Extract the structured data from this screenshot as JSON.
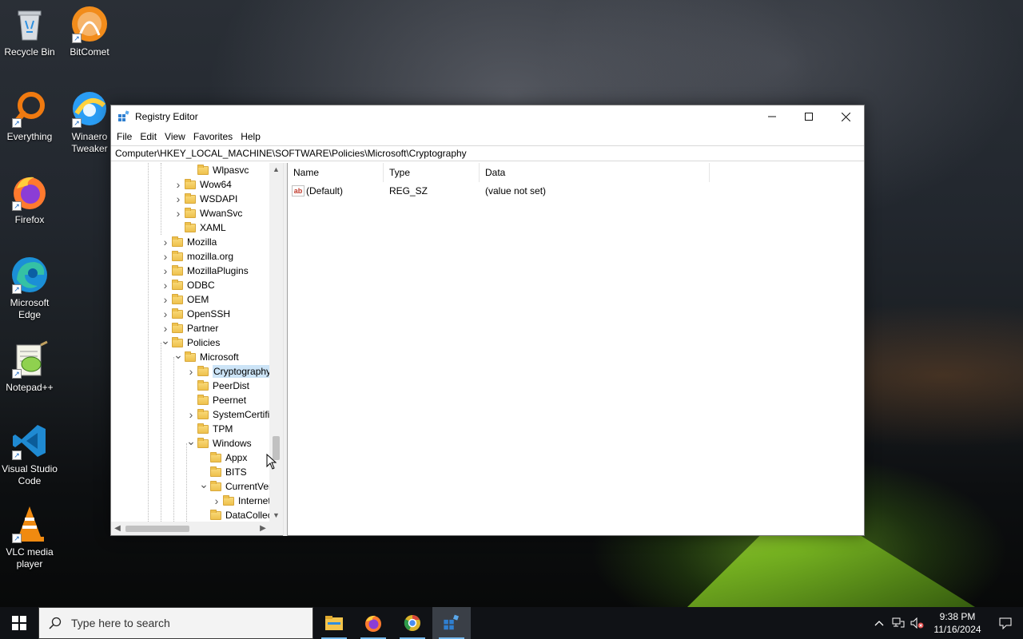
{
  "desktop": {
    "icons": [
      {
        "label": "Recycle Bin",
        "icon": "recycle-bin-icon"
      },
      {
        "label": "BitComet",
        "icon": "bitcomet-icon"
      },
      {
        "label": "Everything",
        "icon": "everything-search-icon"
      },
      {
        "label": "Winaero Tweaker",
        "icon": "winaero-tweaker-icon"
      },
      {
        "label": "Firefox",
        "icon": "firefox-icon"
      },
      {
        "label": "Microsoft Edge",
        "icon": "edge-icon"
      },
      {
        "label": "Notepad++",
        "icon": "notepadpp-icon"
      },
      {
        "label": "Visual Studio Code",
        "icon": "vscode-icon"
      },
      {
        "label": "VLC media player",
        "icon": "vlc-icon"
      }
    ]
  },
  "window": {
    "title": "Registry Editor",
    "menu": [
      "File",
      "Edit",
      "View",
      "Favorites",
      "Help"
    ],
    "address": "Computer\\HKEY_LOCAL_MACHINE\\SOFTWARE\\Policies\\Microsoft\\Cryptography",
    "tree": [
      {
        "label": "Wlpasvc",
        "expander": "",
        "selected": false
      },
      {
        "label": "Wow64",
        "expander": "collapsed",
        "selected": false
      },
      {
        "label": "WSDAPI",
        "expander": "collapsed",
        "selected": false
      },
      {
        "label": "WwanSvc",
        "expander": "collapsed",
        "selected": false
      },
      {
        "label": "XAML",
        "expander": "",
        "selected": false
      },
      {
        "label": "Mozilla",
        "expander": "collapsed",
        "selected": false
      },
      {
        "label": "mozilla.org",
        "expander": "collapsed",
        "selected": false
      },
      {
        "label": "MozillaPlugins",
        "expander": "collapsed",
        "selected": false
      },
      {
        "label": "ODBC",
        "expander": "collapsed",
        "selected": false
      },
      {
        "label": "OEM",
        "expander": "collapsed",
        "selected": false
      },
      {
        "label": "OpenSSH",
        "expander": "collapsed",
        "selected": false
      },
      {
        "label": "Partner",
        "expander": "collapsed",
        "selected": false
      },
      {
        "label": "Policies",
        "expander": "expanded",
        "selected": false
      },
      {
        "label": "Microsoft",
        "expander": "expanded",
        "selected": false
      },
      {
        "label": "Cryptography",
        "expander": "collapsed",
        "selected": true
      },
      {
        "label": "PeerDist",
        "expander": "",
        "selected": false
      },
      {
        "label": "Peernet",
        "expander": "",
        "selected": false
      },
      {
        "label": "SystemCertific",
        "expander": "collapsed",
        "selected": false
      },
      {
        "label": "TPM",
        "expander": "",
        "selected": false
      },
      {
        "label": "Windows",
        "expander": "expanded",
        "selected": false
      },
      {
        "label": "Appx",
        "expander": "",
        "selected": false
      },
      {
        "label": "BITS",
        "expander": "",
        "selected": false
      },
      {
        "label": "CurrentVers",
        "expander": "expanded",
        "selected": false
      },
      {
        "label": "Internet",
        "expander": "collapsed",
        "selected": false
      },
      {
        "label": "DataCollect",
        "expander": "",
        "selected": false
      }
    ],
    "columns": [
      "Name",
      "Type",
      "Data"
    ],
    "values": [
      {
        "name": "(Default)",
        "type": "REG_SZ",
        "data": "(value not set)",
        "icon": "string-value-icon"
      }
    ]
  },
  "taskbar": {
    "search_placeholder": "Type here to search",
    "apps": [
      {
        "name": "file-explorer",
        "icon": "file-explorer-icon"
      },
      {
        "name": "firefox",
        "icon": "firefox-icon"
      },
      {
        "name": "chrome",
        "icon": "chrome-icon"
      },
      {
        "name": "registry-editor",
        "icon": "registry-editor-icon"
      }
    ],
    "time": "9:38 PM",
    "date": "11/16/2024"
  }
}
